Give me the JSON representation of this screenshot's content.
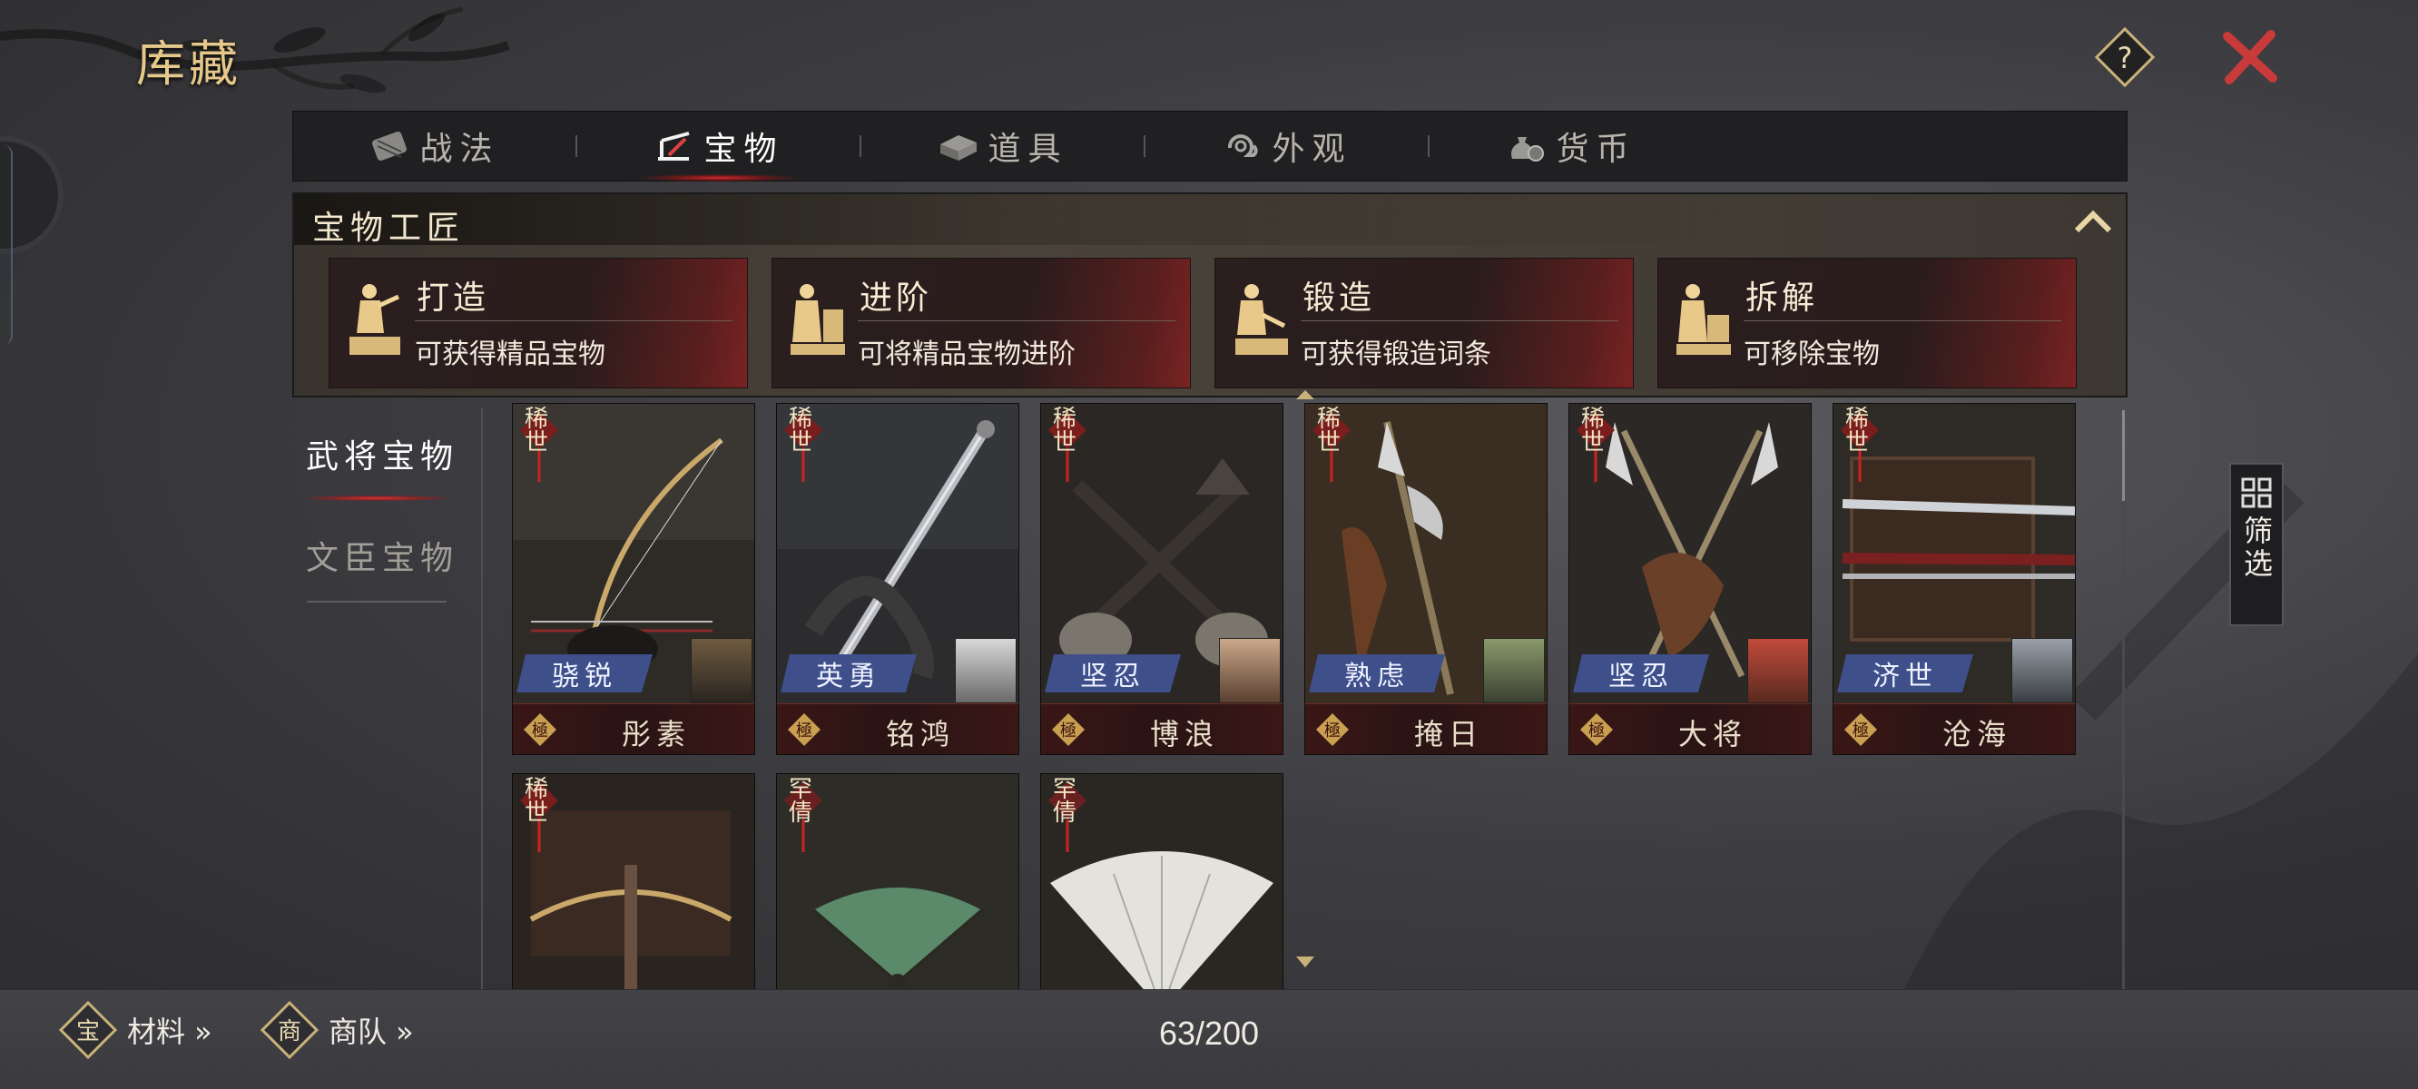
{
  "page": {
    "title": "库藏"
  },
  "tabs": [
    {
      "label": "战法",
      "icon": "scroll-bundle-icon",
      "active": false
    },
    {
      "label": "宝物",
      "icon": "weapon-rack-icon",
      "active": true
    },
    {
      "label": "道具",
      "icon": "chest-icon",
      "active": false
    },
    {
      "label": "外观",
      "icon": "swirl-cloud-icon",
      "active": false
    },
    {
      "label": "货币",
      "icon": "coin-bag-icon",
      "active": false
    }
  ],
  "artisan": {
    "title": "宝物工匠",
    "cards": [
      {
        "name": "打造",
        "desc": "可获得精品宝物"
      },
      {
        "name": "进阶",
        "desc": "可将精品宝物进阶"
      },
      {
        "name": "锻造",
        "desc": "可获得锻造词条"
      },
      {
        "name": "拆解",
        "desc": "可移除宝物"
      }
    ]
  },
  "categories": [
    {
      "label": "武将宝物",
      "active": true
    },
    {
      "label": "文臣宝物",
      "active": false
    }
  ],
  "items": [
    {
      "name": "彤素",
      "rarity": "稀世",
      "trait": "骁锐",
      "grade": "極",
      "art": "bow-icon"
    },
    {
      "name": "铭鸿",
      "rarity": "稀世",
      "trait": "英勇",
      "grade": "極",
      "art": "sword-icon"
    },
    {
      "name": "博浪",
      "rarity": "稀世",
      "trait": "坚忍",
      "grade": "極",
      "art": "crossed-hammers-icon"
    },
    {
      "name": "掩日",
      "rarity": "稀世",
      "trait": "熟虑",
      "grade": "極",
      "art": "halberd-icon"
    },
    {
      "name": "大将",
      "rarity": "稀世",
      "trait": "坚忍",
      "grade": "極",
      "art": "crossed-halberds-icon"
    },
    {
      "name": "沧海",
      "rarity": "稀世",
      "trait": "济世",
      "grade": "極",
      "art": "twin-blades-icon"
    },
    {
      "name": "",
      "rarity": "稀世",
      "trait": "",
      "grade": "",
      "art": "crossbow-icon"
    },
    {
      "name": "",
      "rarity": "罕倩",
      "trait": "",
      "grade": "",
      "art": "green-fan-icon"
    },
    {
      "name": "",
      "rarity": "罕倩",
      "trait": "",
      "grade": "",
      "art": "feather-fan-icon"
    }
  ],
  "filter": {
    "label": "筛选"
  },
  "bottom": {
    "materials": "材料 »",
    "materials_badge": "宝",
    "caravan": "商队 »",
    "caravan_badge": "商",
    "capacity": "63/200"
  },
  "colors": {
    "accent_gold": "#e6c98a",
    "close_red": "#c93a3a",
    "active_tab_glow": "#d22a2a",
    "card_red": "#7a2323"
  }
}
